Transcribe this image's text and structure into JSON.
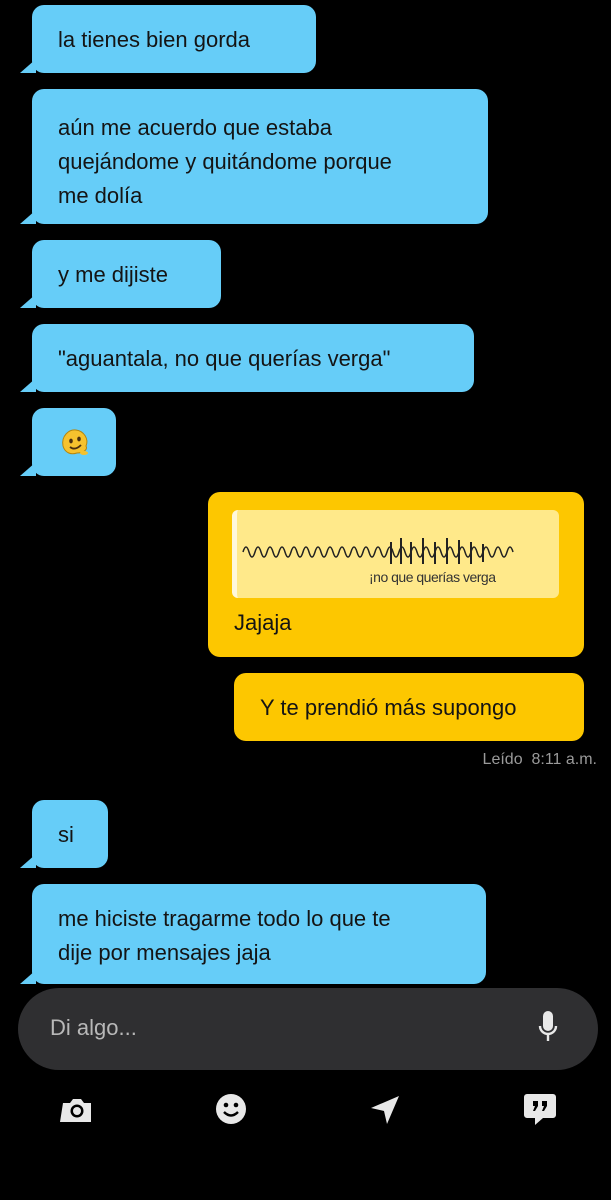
{
  "messages": [
    {
      "dir": "in",
      "text": "la tienes bien gorda"
    },
    {
      "dir": "in",
      "text": "aún me acuerdo que estaba\nquejándome y quitándome porque\nme dolía"
    },
    {
      "dir": "in",
      "text": "y me dijiste"
    },
    {
      "dir": "in",
      "text": "\"aguantala, no que querías verga\""
    },
    {
      "dir": "in",
      "emoji": "face-with-spiral-eyes/melting sticker"
    },
    {
      "dir": "out",
      "quote": "¡no que querías verga",
      "text": "Jajaja"
    },
    {
      "dir": "out",
      "text": "Y te prendió más supongo"
    },
    {
      "dir": "in",
      "text": "si"
    },
    {
      "dir": "in",
      "text": "me hiciste tragarme todo lo que te\ndije por mensajes jaja"
    }
  ],
  "read_status": {
    "label": "Leído",
    "time": "8:11 a.m."
  },
  "composer": {
    "placeholder": "Di algo..."
  },
  "toolbar": [
    "camera-icon",
    "emoji-icon",
    "location-icon",
    "quote-icon"
  ],
  "colors": {
    "incoming": "#66cdf8",
    "outgoing": "#fdc700",
    "background": "#000000"
  }
}
